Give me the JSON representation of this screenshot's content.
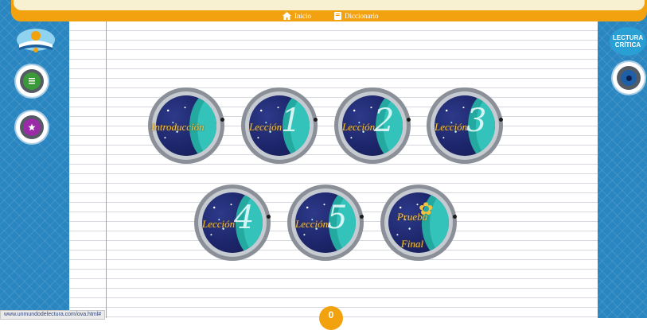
{
  "topbar": {
    "inicio_label": "Inicio",
    "diccionario_label": "Diccionario"
  },
  "right_logo": {
    "line1": "LECTURA",
    "line2": "CRÍTICA"
  },
  "lessons": [
    {
      "word": "Introducción",
      "number": ""
    },
    {
      "word": "Lección",
      "number": "1"
    },
    {
      "word": "Lección",
      "number": "2"
    },
    {
      "word": "Lección",
      "number": "3"
    },
    {
      "word": "Lección",
      "number": "4"
    },
    {
      "word": "Lección",
      "number": "5"
    },
    {
      "word": "Prueba Final",
      "number": ""
    }
  ],
  "status_url": "www.unmundodelectura.com/ova.html#",
  "bottom_badge": "0",
  "colors": {
    "topbar": "#f3a20f",
    "side_panel": "#2a86c0",
    "list_button": "#3a9a3a",
    "purple_button": "#9a2aa8",
    "porthole_glass": "#1c2569",
    "porthole_teal": "#24a9a0",
    "lesson_text": "#f5c23d"
  },
  "icons": {
    "home": "home-icon",
    "dictionary": "book-icon",
    "list": "list-icon",
    "star": "star-icon"
  }
}
